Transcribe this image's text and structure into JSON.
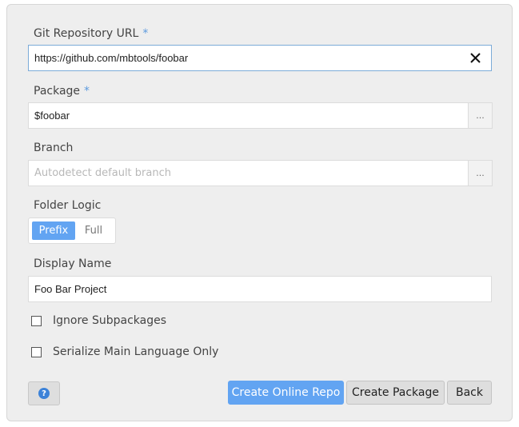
{
  "form": {
    "git_url": {
      "label": "Git Repository URL",
      "required_mark": "*",
      "value": "https://github.com/mbtools/foobar"
    },
    "package": {
      "label": "Package",
      "required_mark": "*",
      "value": "$foobar",
      "browse_label": "..."
    },
    "branch": {
      "label": "Branch",
      "placeholder": "Autodetect default branch",
      "browse_label": "..."
    },
    "folder_logic": {
      "label": "Folder Logic",
      "options": [
        "Prefix",
        "Full"
      ],
      "selected": "Prefix"
    },
    "display_name": {
      "label": "Display Name",
      "value": "Foo Bar Project"
    },
    "checkboxes": [
      {
        "label": "Ignore Subpackages",
        "checked": false
      },
      {
        "label": "Serialize Main Language Only",
        "checked": false
      }
    ]
  },
  "footer": {
    "help_icon": "question-circle-icon",
    "help_glyph": "?",
    "create_online_label": "Create Online Repo",
    "create_package_label": "Create Package",
    "back_label": "Back"
  },
  "colors": {
    "accent": "#62a4f2",
    "required": "#5d9bde",
    "panel": "#eeeeee"
  }
}
